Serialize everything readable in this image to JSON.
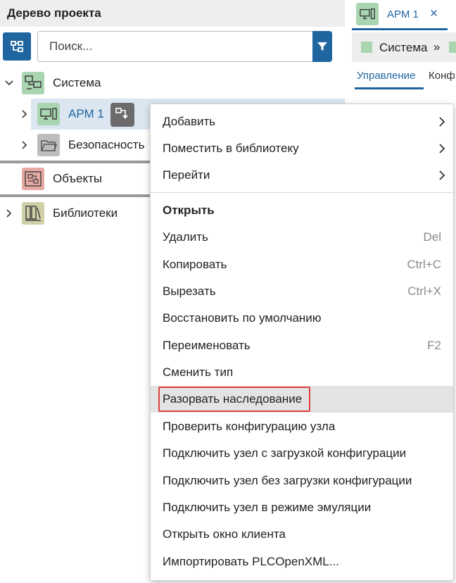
{
  "panel": {
    "title": "Дерево проекта",
    "search_placeholder": "Поиск..."
  },
  "tree": {
    "system": "Система",
    "apm": "АРМ 1",
    "security": "Безопасность",
    "objects": "Объекты",
    "libraries": "Библиотеки"
  },
  "right": {
    "tab_label": "АРМ 1",
    "tab_close": "×",
    "crumb_label": "Система",
    "crumb_sep": "»",
    "subtab_active": "Управление",
    "subtab_next": "Конф"
  },
  "menu": {
    "items": [
      {
        "label": "Добавить",
        "shortcut": "",
        "submenu": true
      },
      {
        "label": "Поместить в библиотеку",
        "shortcut": "",
        "submenu": true
      },
      {
        "label": "Перейти",
        "shortcut": "",
        "submenu": true
      },
      {
        "label": "Открыть",
        "shortcut": "",
        "bold": true
      },
      {
        "label": "Удалить",
        "shortcut": "Del"
      },
      {
        "label": "Копировать",
        "shortcut": "Ctrl+C"
      },
      {
        "label": "Вырезать",
        "shortcut": "Ctrl+X"
      },
      {
        "label": "Восстановить по умолчанию",
        "shortcut": ""
      },
      {
        "label": "Переименовать",
        "shortcut": "F2"
      },
      {
        "label": "Сменить тип",
        "shortcut": ""
      },
      {
        "label": "Разорвать наследование",
        "shortcut": "",
        "hovered": true
      },
      {
        "label": "Проверить конфигурацию узла",
        "shortcut": ""
      },
      {
        "label": "Подключить узел с загрузкой конфигурации",
        "shortcut": ""
      },
      {
        "label": "Подключить узел без загрузки конфигурации",
        "shortcut": ""
      },
      {
        "label": "Подключить узел в режиме эмуляции",
        "shortcut": ""
      },
      {
        "label": "Открыть окно клиента",
        "shortcut": ""
      },
      {
        "label": "Импортировать PLCOpenXML...",
        "shortcut": ""
      }
    ]
  },
  "colors": {
    "accent": "#1f65a0",
    "selection": "#dbe6f1",
    "highlight": "#e04040"
  }
}
